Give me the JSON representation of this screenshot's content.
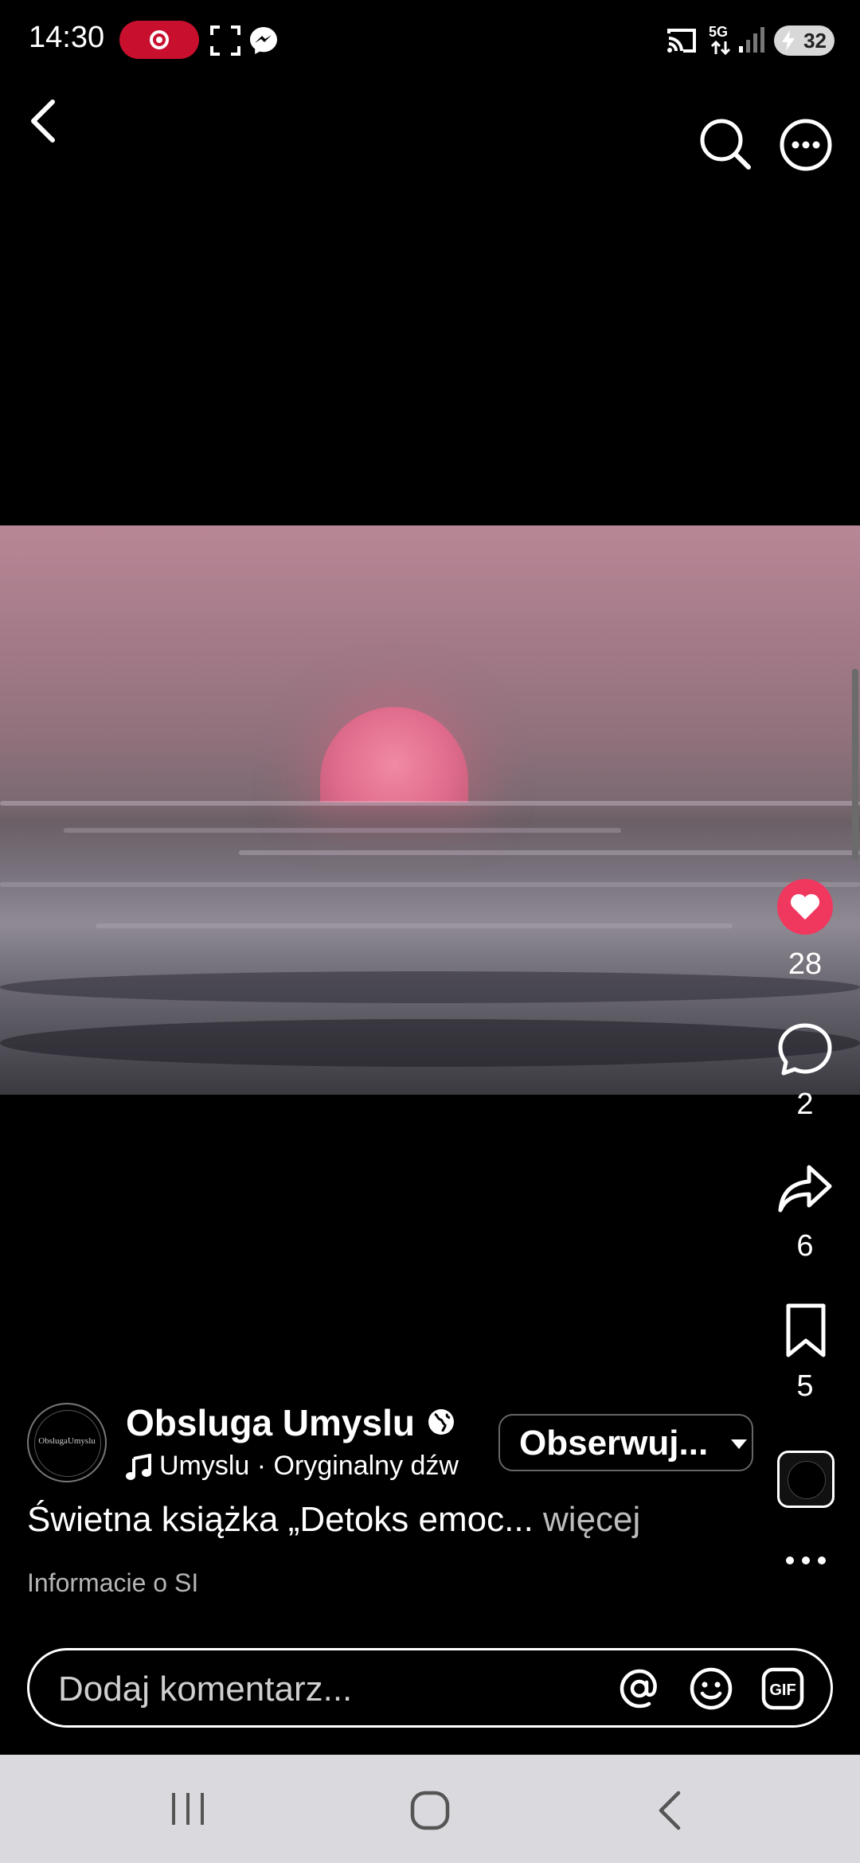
{
  "status_bar": {
    "time": "14:30",
    "battery": "32",
    "network": "5G"
  },
  "video": {
    "description": "sunset over the sea"
  },
  "actions": {
    "likes": "28",
    "comments": "2",
    "shares": "6",
    "saves": "5"
  },
  "author": {
    "name": "Obsluga Umyslu",
    "audio": "Umyslu · Oryginalny dźw",
    "avatar_text": "ObslugaUmyslu",
    "follow_label": "Obserwuj..."
  },
  "caption": {
    "text": "Świetna książka „Detoks emoc...",
    "more": "więcej",
    "ai_info": "Informacie o SI"
  },
  "comment": {
    "placeholder": "Dodaj komentarz..."
  },
  "colors": {
    "like": "#f0385f",
    "accent": "#ffffff"
  }
}
